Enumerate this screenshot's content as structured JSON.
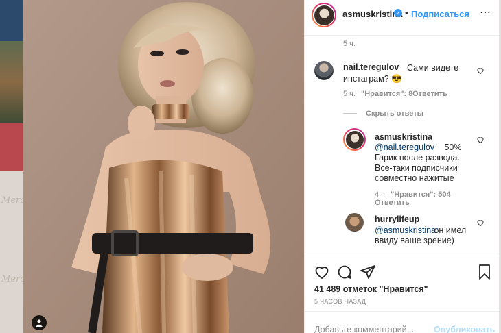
{
  "header": {
    "username": "asmuskristina",
    "verified_mark": "✓",
    "separator": "•",
    "follow_label": "Подписаться",
    "more_label": "⋯"
  },
  "top_meta": {
    "time": "5 ч."
  },
  "comments": [
    {
      "username": "nail.teregulov",
      "text": "Сами видете",
      "text_line2": "инстаграм? 😎",
      "time": "5 ч.",
      "likes": "\"Нравится\": 8",
      "reply_label": "Ответить",
      "hide_replies_label": "Скрыть ответы"
    }
  ],
  "replies": [
    {
      "username": "asmuskristina",
      "mention": "@nail.teregulov",
      "text_after_mention": " 50%",
      "line2": "Гарик после развода.",
      "line3": "Все-таки подписчики",
      "line4": "совместно нажитые",
      "time": "4 ч.",
      "likes": "\"Нравится\": 504",
      "reply_label": "Ответить"
    },
    {
      "username": "hurrylifeup",
      "mention": "@asmuskristina",
      "text_after_mention": " он имел",
      "line2": "ввиду ваше зрение)"
    }
  ],
  "actions": {
    "likes_text": "41 489 отметок \"Нравится\"",
    "posted_time": "5 ЧАСОВ НАЗАД",
    "comment_placeholder": "Добавьте комментарий...",
    "publish_label": "Опубликовать"
  },
  "background_page": {
    "ghost_text": "Mercury"
  },
  "colors": {
    "accent": "#3897f0",
    "text": "#262626",
    "muted": "#8e8e8e",
    "publish_disabled": "#b2dffc"
  },
  "icons": [
    "verified-badge-icon",
    "more-icon",
    "heart-icon",
    "comment-icon",
    "share-icon",
    "bookmark-icon",
    "user-tag-icon"
  ]
}
